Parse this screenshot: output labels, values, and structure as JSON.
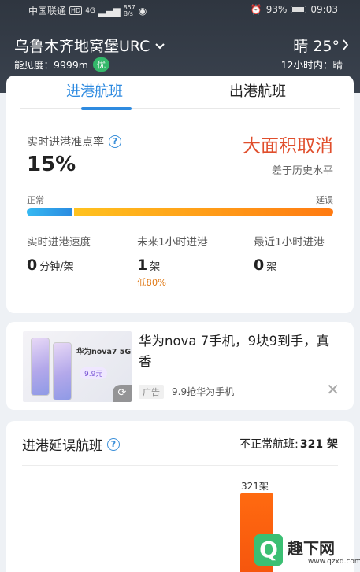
{
  "status_bar": {
    "carrier": "中国联通",
    "hd": "HD",
    "signal": "4G",
    "net_speed_value": "857",
    "net_speed_unit": "B/s",
    "battery": "93%",
    "time": "09:03"
  },
  "header": {
    "airport": "乌鲁木齐地窝堡URC",
    "weather": "晴 25°",
    "visibility": "能见度：9999m",
    "air_quality": "优",
    "forecast": "12小时内：晴"
  },
  "tabs": [
    {
      "label": "进港航班",
      "active": true
    },
    {
      "label": "出港航班",
      "active": false
    }
  ],
  "punctuality": {
    "label": "实时进港准点率",
    "value": "15%",
    "status": "大面积取消",
    "status_sub": "差于历史水平",
    "scale_left": "正常",
    "scale_right": "延误",
    "level": 0.15
  },
  "stats": [
    {
      "label": "实时进港速度",
      "value": "0",
      "unit": "分钟/架",
      "sub": ""
    },
    {
      "label": "未来1小时进港",
      "value": "1",
      "unit": "架",
      "sub": "低80%"
    },
    {
      "label": "最近1小时进港",
      "value": "0",
      "unit": "架",
      "sub": ""
    }
  ],
  "ad": {
    "title": "华为nova 7手机，9块9到手，真香",
    "tag": "广告",
    "subtitle": "9.9抢华为手机",
    "image_brand": "华为nova7 5G",
    "image_price": "9.9元"
  },
  "delay_section": {
    "title": "进港延误航班",
    "count_label": "不正常航班:",
    "count_value": "321 架",
    "bar_label": "321架"
  },
  "watermark": {
    "text": "趣下网",
    "url": "www.qzxd.com"
  },
  "colors": {
    "accent": "#2f8be0",
    "alert": "#e04e2c",
    "bar_orange": "#ff7a12",
    "good": "#33b86a"
  }
}
